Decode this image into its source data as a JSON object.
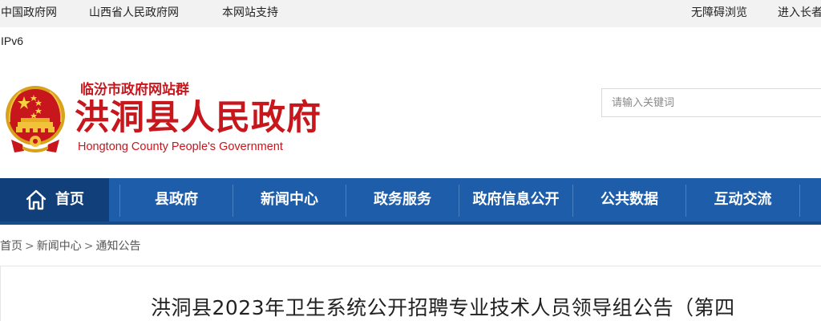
{
  "topbar": {
    "left_links": [
      "中国政府网",
      "山西省人民政府网",
      "本网站支持"
    ],
    "right_links": [
      "无障碍浏览",
      "进入长者"
    ]
  },
  "ipv6_label": "IPv6",
  "header": {
    "site_group": "临汾市政府网站群",
    "title": "洪洞县人民政府",
    "title_en": "Hongtong County People's Government"
  },
  "search": {
    "placeholder": "请输入关键词"
  },
  "nav": {
    "items": [
      "首页",
      "县政府",
      "新闻中心",
      "政务服务",
      "政府信息公开",
      "公共数据",
      "互动交流"
    ]
  },
  "breadcrumb": {
    "items": [
      "首页",
      "新闻中心",
      "通知公告"
    ],
    "separator": ">"
  },
  "article": {
    "title": "洪洞县2023年卫生系统公开招聘专业技术人员领导组公告（第四"
  },
  "colors": {
    "brand_red": "#c8161d",
    "nav_blue": "#1d5da9",
    "nav_active": "#113f7a",
    "topbar_bg": "#f2f2f2"
  }
}
